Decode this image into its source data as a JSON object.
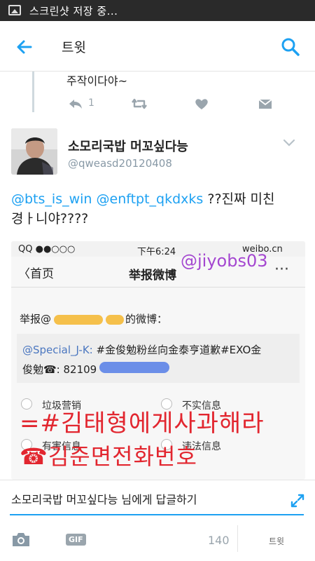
{
  "status_bar": {
    "text": "스크린샷 저장 중..."
  },
  "app_bar": {
    "title": "트윗"
  },
  "previous_tweet": {
    "text": "주작이다야~",
    "reply_count": "1"
  },
  "tweet": {
    "display_name": "소모리국밥 머꼬싶다능",
    "handle": "@qweasd20120408",
    "mention1": "@bts_is_win",
    "mention2": "@enftpt_qkdxks",
    "text_tail": "??진짜 미친",
    "text_line2": "경ㅏ니야????"
  },
  "media": {
    "status_left": "QQ ●●○○○",
    "status_time": "下午6:24",
    "status_right": "weibo.cn",
    "nav_back": "〈首页",
    "nav_title": "举报微博",
    "nav_dots": "···",
    "watermark": "@jiyobs03",
    "report_prefix": "举报@",
    "report_suffix": "的微博：",
    "quote_handle": "@Special_J-K:",
    "quote_text": "#金俊勉粉丝向金泰亨道歉#EXO金",
    "quote_line2": "俊勉☎: 82109",
    "options": [
      "垃圾营销",
      "不实信息",
      "有害信息",
      "违法信息"
    ],
    "overlay_line1": "=#김태형에게사과해라",
    "overlay_line2": "☎김준면전화번호"
  },
  "compose": {
    "placeholder": "소모리국밥 머꼬싶다능 님에게 답글하기",
    "gif_label": "GIF",
    "char_count": "140",
    "tweet_label": "트윗"
  },
  "colors": {
    "accent": "#1da1f2",
    "muted": "#9aa5ad",
    "overlay_red": "#e2262f"
  }
}
